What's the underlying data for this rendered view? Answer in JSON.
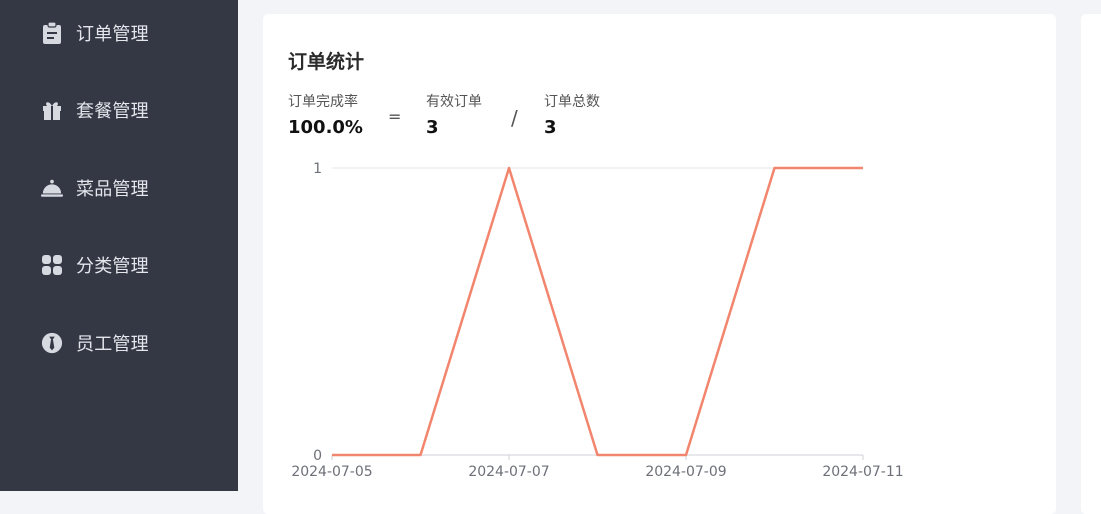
{
  "sidebar": {
    "items": [
      {
        "label": "订单管理",
        "icon": "clipboard-icon"
      },
      {
        "label": "套餐管理",
        "icon": "gift-icon"
      },
      {
        "label": "菜品管理",
        "icon": "dish-cloche-icon"
      },
      {
        "label": "分类管理",
        "icon": "grid-icon"
      },
      {
        "label": "员工管理",
        "icon": "employee-icon"
      }
    ]
  },
  "order_stats": {
    "title": "订单统计",
    "completion_rate_label": "订单完成率",
    "completion_rate_value": "100.0%",
    "equals": "=",
    "valid_orders_label": "有效订单",
    "valid_orders_value": "3",
    "divide": "/",
    "total_orders_label": "订单总数",
    "total_orders_value": "3"
  },
  "chart_data": {
    "type": "line",
    "x": [
      "2024-07-05",
      "2024-07-06",
      "2024-07-07",
      "2024-07-08",
      "2024-07-09",
      "2024-07-10",
      "2024-07-11"
    ],
    "x_tick_labels": [
      "2024-07-05",
      "2024-07-07",
      "2024-07-09",
      "2024-07-11"
    ],
    "series": [
      {
        "values": [
          0,
          0,
          1,
          0,
          0,
          1,
          1
        ],
        "color": "#f2856d"
      }
    ],
    "y_tick_labels": [
      "0",
      "1"
    ],
    "ylim": [
      0,
      1
    ],
    "grid": true
  }
}
